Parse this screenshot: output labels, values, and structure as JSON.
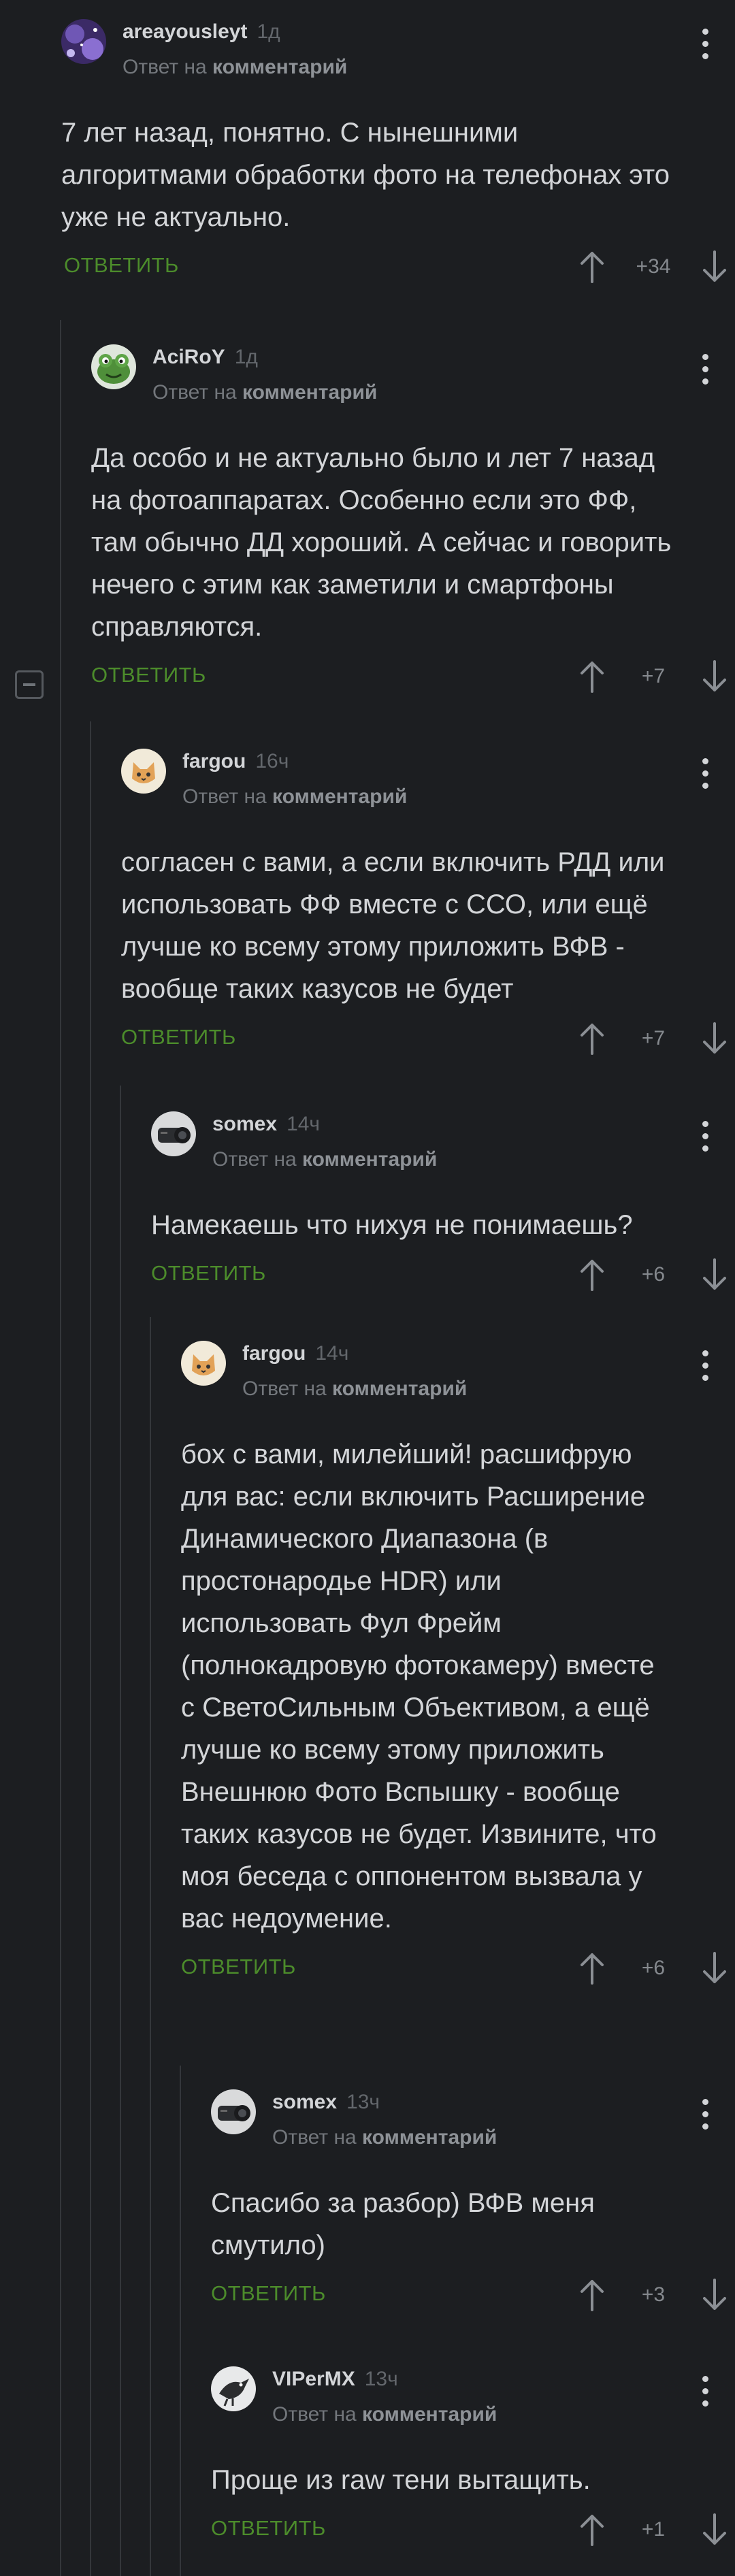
{
  "labels": {
    "reply_to_prefix": "Ответ на",
    "reply_to_target": "комментарий",
    "reply_button": "ОТВЕТИТЬ"
  },
  "colors": {
    "background": "#1c1e21",
    "reply_green": "#4c8c2b",
    "thread_line": "#34373b"
  },
  "icons": {
    "menu": "more-vertical-icon",
    "upvote": "arrow-up-icon",
    "downvote": "arrow-down-icon",
    "collapse": "minus-square-icon"
  },
  "comments": [
    {
      "author": "areayousleyt",
      "time": "1д",
      "text": "7 лет назад, понятно. С нынешними алгоритмами обработки фото на телефонах это уже не актуально.",
      "rating": "+34",
      "avatar": "galaxy"
    },
    {
      "author": "AciRoY",
      "time": "1д",
      "text": "Да особо и не актуально было и лет 7 назад на фотоаппаратах. Особенно если это ФФ, там обычно ДД хороший. А сейчас и говорить нечего с этим как заметили и смартфоны справляются.",
      "rating": "+7",
      "avatar": "frog"
    },
    {
      "author": "fargou",
      "time": "16ч",
      "text": "согласен с вами, а если включить РДД или использовать ФФ вместе с ССО, или ещё лучше ко всему этому приложить ВФВ - вообще таких казусов не будет",
      "rating": "+7",
      "avatar": "cat"
    },
    {
      "author": "somex",
      "time": "14ч",
      "text": "Намекаешь что нихуя не понимаешь?",
      "rating": "+6",
      "avatar": "lens"
    },
    {
      "author": "fargou",
      "time": "14ч",
      "text": "бох с вами, милейший! расшифрую для вас: если включить Расширение Динамического Диапазона (в простонародье HDR) или использовать Фул Фрейм (полнокадровую фотокамеру) вместе с СветоСильным Объективом, а ещё лучше ко всему этому приложить Внешнюю Фото Вспышку - вообще таких казусов не будет. Извините, что моя беседа с оппонентом вызвала у вас недоумение.",
      "rating": "+6",
      "avatar": "cat"
    },
    {
      "author": "somex",
      "time": "13ч",
      "text": "Спасибо за разбор) ВФВ меня смутило)",
      "rating": "+3",
      "avatar": "lens"
    },
    {
      "author": "VIPerMX",
      "time": "13ч",
      "text": "Проще из raw тени вытащить.",
      "rating": "+1",
      "avatar": "bird"
    }
  ]
}
